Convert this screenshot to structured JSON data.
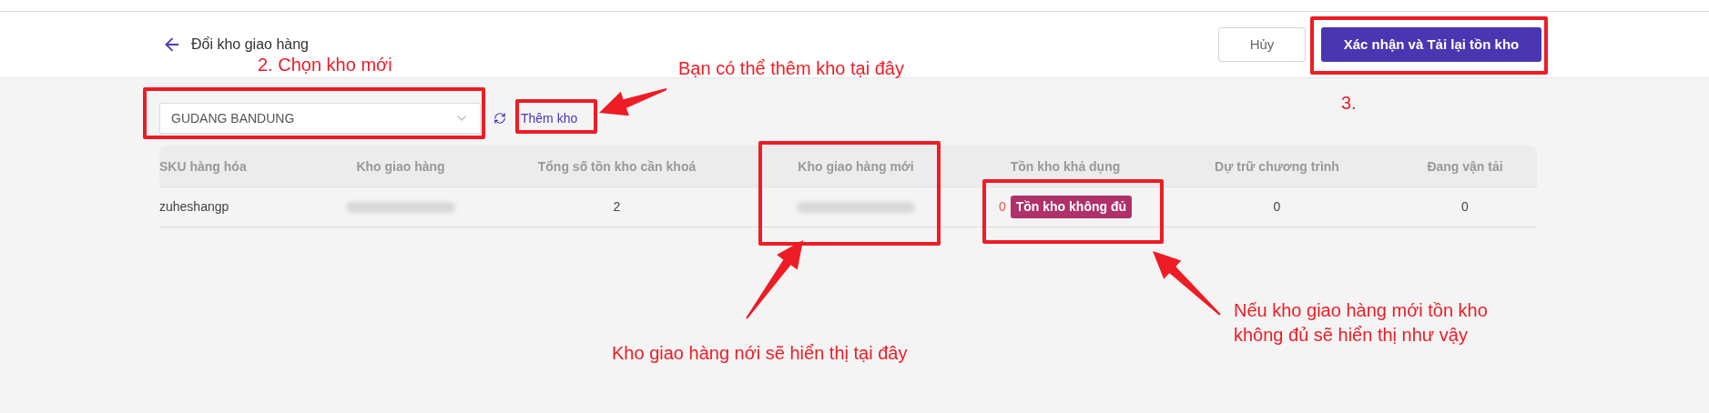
{
  "header": {
    "title": "Đổi kho giao hàng",
    "buttons": [
      {
        "label": "Hủy",
        "kind": "secondary"
      },
      {
        "label": "Xác nhận và Tải lại tồn kho",
        "kind": "primary"
      }
    ]
  },
  "toolbar": {
    "warehouse_select": {
      "value": "GUDANG BANDUNG"
    },
    "add_link": "Thêm kho"
  },
  "table": {
    "columns": [
      "SKU hàng hóa",
      "Kho giao hàng",
      "Tổng số tồn kho cần khoá",
      "Kho giao hàng mới",
      "Tồn kho khả dụng",
      "Dự trữ chương trình",
      "Đang vận tải"
    ],
    "rows": [
      {
        "cells": [
          {
            "kind": "text",
            "text": "zuheshangp"
          },
          {
            "kind": "redacted"
          },
          {
            "kind": "text",
            "text": "2"
          },
          {
            "kind": "redacted"
          },
          {
            "kind": "stock",
            "text": "0",
            "badge": "Tồn kho không đủ"
          },
          {
            "kind": "text",
            "text": "0"
          },
          {
            "kind": "text",
            "text": "0"
          }
        ]
      }
    ]
  },
  "annotations": [
    {
      "text": "2. Chọn kho mới"
    },
    {
      "text": "Bạn có thể thêm kho tại đây"
    },
    {
      "text": "3."
    },
    {
      "text": "Kho giao hàng nới sẽ hiển thị tại đây"
    },
    {
      "text": "Nếu kho giao hàng mới tồn kho không đủ sẽ hiển thị như vậy"
    }
  ]
}
